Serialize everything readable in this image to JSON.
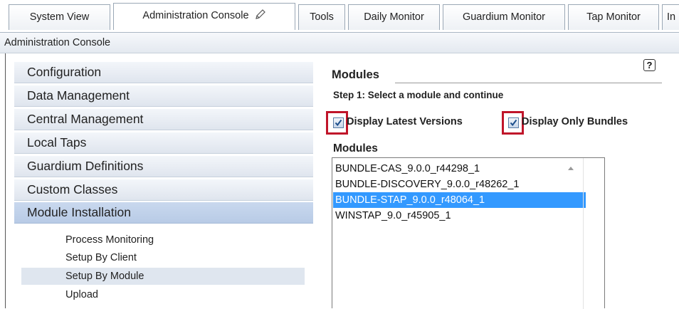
{
  "tabs": [
    {
      "label": "System View"
    },
    {
      "label": "Administration Console",
      "active": true,
      "icon": "pencil-icon"
    },
    {
      "label": "Tools"
    },
    {
      "label": "Daily Monitor"
    },
    {
      "label": "Guardium Monitor"
    },
    {
      "label": "Tap Monitor"
    },
    {
      "label": "In"
    }
  ],
  "breadcrumb": "Administration Console",
  "sidebar": {
    "items": [
      {
        "label": "Configuration"
      },
      {
        "label": "Data Management"
      },
      {
        "label": "Central Management"
      },
      {
        "label": "Local Taps"
      },
      {
        "label": "Guardium Definitions"
      },
      {
        "label": "Custom Classes"
      },
      {
        "label": "Module Installation",
        "active": true
      }
    ],
    "sub_items": [
      {
        "label": "Process Monitoring"
      },
      {
        "label": "Setup By Client"
      },
      {
        "label": "Setup By Module",
        "selected": true
      },
      {
        "label": "Upload"
      }
    ]
  },
  "main": {
    "title": "Modules",
    "help": "?",
    "step": "Step 1:  Select a module and continue",
    "checkboxes": [
      {
        "label": "Display Latest Versions",
        "checked": true
      },
      {
        "label": "Display Only Bundles",
        "checked": true
      }
    ],
    "list_title": "Modules",
    "modules": [
      {
        "label": "BUNDLE-CAS_9.0.0_r44298_1"
      },
      {
        "label": "BUNDLE-DISCOVERY_9.0.0_r48262_1"
      },
      {
        "label": "BUNDLE-STAP_9.0.0_r48064_1",
        "selected": true
      },
      {
        "label": "WINSTAP_9.0_r45905_1"
      }
    ]
  },
  "colors": {
    "selection": "#3399ff",
    "highlight_box": "#c0152a",
    "sidebar_active": "#c9d8ee"
  }
}
